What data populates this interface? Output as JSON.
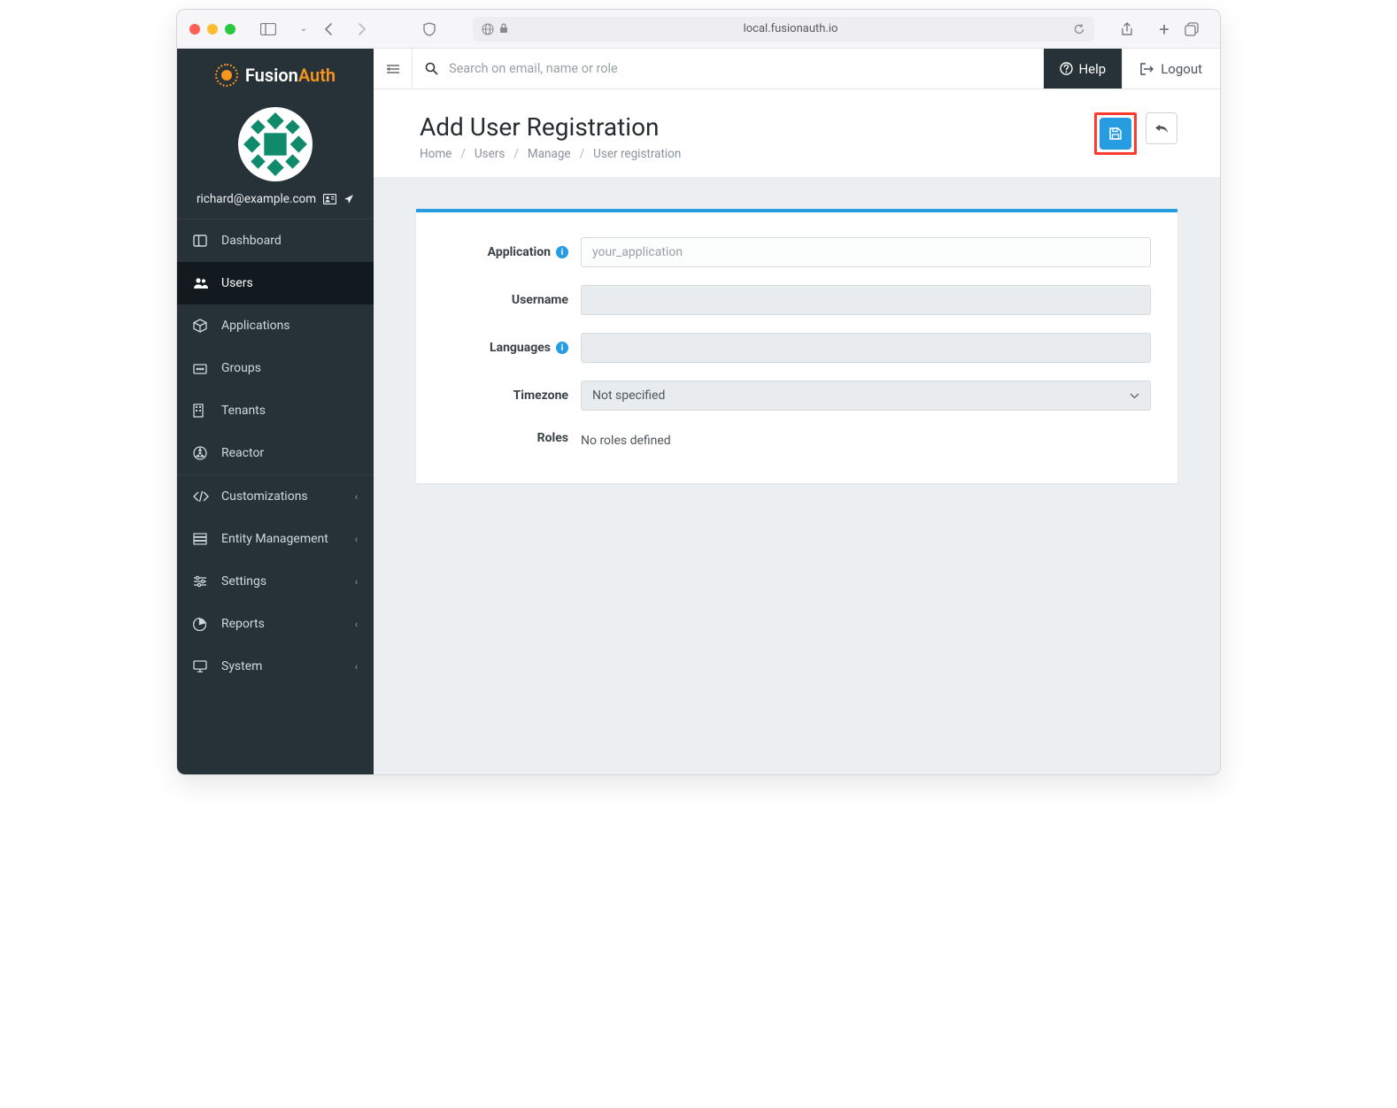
{
  "browser": {
    "url": "local.fusionauth.io"
  },
  "brand": {
    "name_a": "Fusion",
    "name_b": "Auth"
  },
  "user": {
    "email": "richard@example.com"
  },
  "sidebar": {
    "items": [
      {
        "label": "Dashboard"
      },
      {
        "label": "Users"
      },
      {
        "label": "Applications"
      },
      {
        "label": "Groups"
      },
      {
        "label": "Tenants"
      },
      {
        "label": "Reactor"
      },
      {
        "label": "Customizations"
      },
      {
        "label": "Entity Management"
      },
      {
        "label": "Settings"
      },
      {
        "label": "Reports"
      },
      {
        "label": "System"
      }
    ]
  },
  "topbar": {
    "search_placeholder": "Search on email, name or role",
    "help": "Help",
    "logout": "Logout"
  },
  "page": {
    "title": "Add User Registration",
    "crumbs": [
      "Home",
      "Users",
      "Manage",
      "User registration"
    ]
  },
  "form": {
    "application_label": "Application",
    "application_placeholder": "your_application",
    "username_label": "Username",
    "languages_label": "Languages",
    "timezone_label": "Timezone",
    "timezone_value": "Not specified",
    "roles_label": "Roles",
    "roles_value": "No roles defined"
  }
}
